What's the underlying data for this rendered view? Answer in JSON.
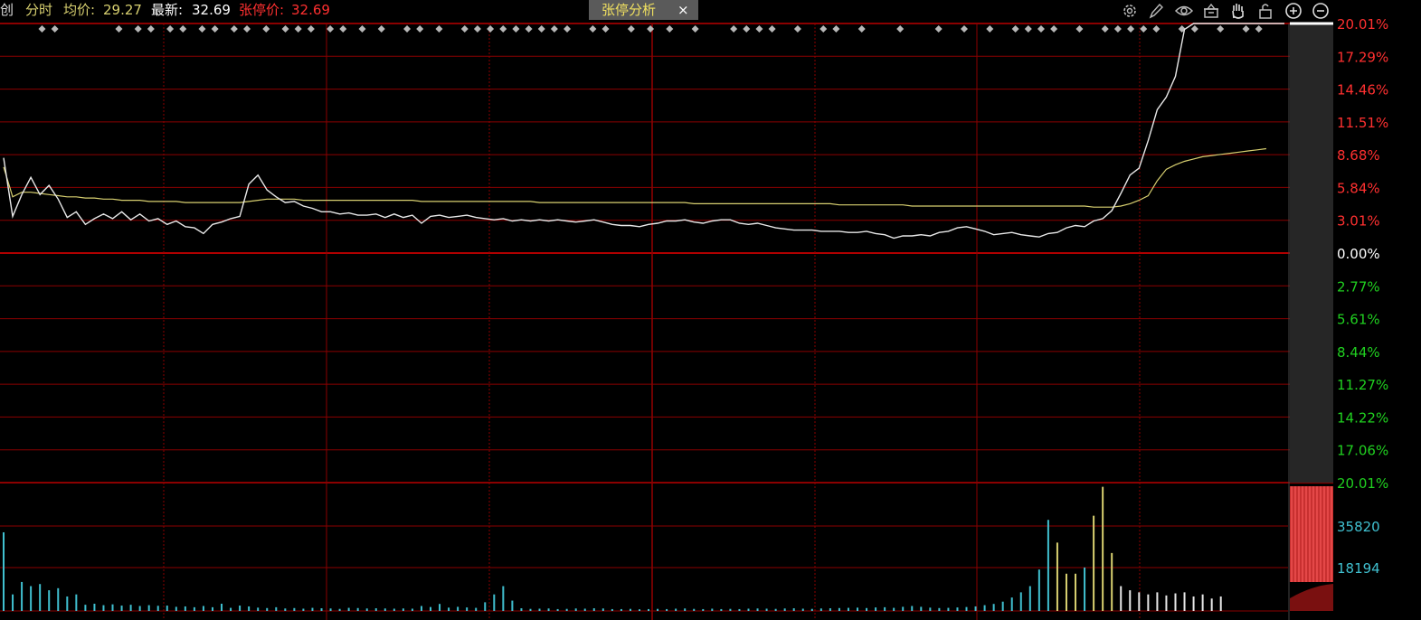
{
  "header": {
    "stock_name_fragment": "创",
    "mode_label": "分时",
    "avg_label": "均价:",
    "avg_value": "29.27",
    "latest_label": "最新:",
    "latest_value": "32.69",
    "limit_label": "张停价:",
    "limit_value": "32.69"
  },
  "tab": {
    "label": "张停分析",
    "close_glyph": "×"
  },
  "toolbar": {
    "icons": [
      "gear-icon",
      "pen-icon",
      "eye-icon",
      "basket-icon",
      "hand-icon",
      "lock-icon",
      "zoom-in-icon",
      "zoom-out-icon"
    ]
  },
  "colors": {
    "grid": "#8b0000",
    "price_line": "#e8e8e8",
    "avg_line": "#d8d070",
    "up_pct": "#ff3030",
    "down_pct": "#20d020",
    "volume_bar": "#40c0d0",
    "volume_bar_up": "#d8d070",
    "marker": "#b8b8b8",
    "tab_bg": "#5a5a5a",
    "tab_text": "#f0e060"
  },
  "chart_data": {
    "type": "line",
    "y_ticks_up": [
      "20.01%",
      "17.29%",
      "14.46%",
      "11.51%",
      "8.68%",
      "5.84%",
      "3.01%"
    ],
    "y_tick_zero": "0.00%",
    "y_ticks_down": [
      "2.77%",
      "5.61%",
      "8.44%",
      "11.27%",
      "14.22%",
      "17.06%",
      "20.01%"
    ],
    "ylim": [
      -20.01,
      20.01
    ],
    "volume_ticks": [
      "35820",
      "18194"
    ],
    "grid": true,
    "price_pct": [
      8.3,
      3.2,
      5.1,
      6.6,
      5.1,
      5.9,
      4.7,
      3.1,
      3.6,
      2.5,
      3.0,
      3.4,
      3.0,
      3.6,
      2.9,
      3.4,
      2.8,
      3.0,
      2.5,
      2.8,
      2.3,
      2.2,
      1.7,
      2.5,
      2.7,
      3.0,
      3.2,
      6.0,
      6.8,
      5.5,
      4.9,
      4.4,
      4.5,
      4.1,
      3.9,
      3.6,
      3.6,
      3.4,
      3.5,
      3.3,
      3.3,
      3.4,
      3.1,
      3.4,
      3.1,
      3.3,
      2.6,
      3.2,
      3.3,
      3.1,
      3.2,
      3.3,
      3.1,
      3.0,
      2.9,
      3.0,
      2.8,
      2.9,
      2.8,
      2.9,
      2.8,
      2.9,
      2.8,
      2.7,
      2.8,
      2.9,
      2.7,
      2.5,
      2.4,
      2.4,
      2.3,
      2.5,
      2.6,
      2.8,
      2.8,
      2.9,
      2.7,
      2.6,
      2.8,
      2.9,
      2.9,
      2.6,
      2.5,
      2.6,
      2.4,
      2.2,
      2.1,
      2.0,
      2.0,
      2.0,
      1.9,
      1.9,
      1.9,
      1.8,
      1.8,
      1.9,
      1.7,
      1.6,
      1.3,
      1.5,
      1.5,
      1.6,
      1.5,
      1.8,
      1.9,
      2.2,
      2.3,
      2.1,
      1.9,
      1.6,
      1.7,
      1.8,
      1.6,
      1.5,
      1.4,
      1.7,
      1.8,
      2.2,
      2.4,
      2.3,
      2.8,
      3.0,
      3.7,
      5.2,
      6.8,
      7.4,
      9.8,
      12.5,
      13.6,
      15.4,
      19.5,
      20.01,
      20.01,
      20.01,
      20.01,
      20.01,
      20.01,
      20.01,
      20.01,
      20.01,
      20.01,
      20.01
    ],
    "avg_pct": [
      7.5,
      4.9,
      5.3,
      5.3,
      5.2,
      5.1,
      5.0,
      4.9,
      4.9,
      4.8,
      4.8,
      4.7,
      4.7,
      4.6,
      4.6,
      4.6,
      4.5,
      4.5,
      4.5,
      4.5,
      4.4,
      4.4,
      4.4,
      4.4,
      4.4,
      4.4,
      4.4,
      4.5,
      4.6,
      4.7,
      4.7,
      4.7,
      4.7,
      4.6,
      4.6,
      4.6,
      4.6,
      4.6,
      4.6,
      4.6,
      4.6,
      4.6,
      4.6,
      4.6,
      4.6,
      4.6,
      4.5,
      4.5,
      4.5,
      4.5,
      4.5,
      4.5,
      4.5,
      4.5,
      4.5,
      4.5,
      4.5,
      4.5,
      4.5,
      4.4,
      4.4,
      4.4,
      4.4,
      4.4,
      4.4,
      4.4,
      4.4,
      4.4,
      4.4,
      4.4,
      4.4,
      4.4,
      4.4,
      4.4,
      4.4,
      4.4,
      4.3,
      4.3,
      4.3,
      4.3,
      4.3,
      4.3,
      4.3,
      4.3,
      4.3,
      4.3,
      4.3,
      4.3,
      4.3,
      4.3,
      4.3,
      4.3,
      4.2,
      4.2,
      4.2,
      4.2,
      4.2,
      4.2,
      4.2,
      4.2,
      4.1,
      4.1,
      4.1,
      4.1,
      4.1,
      4.1,
      4.1,
      4.1,
      4.1,
      4.1,
      4.1,
      4.1,
      4.1,
      4.1,
      4.1,
      4.1,
      4.1,
      4.1,
      4.1,
      4.1,
      4.0,
      4.0,
      4.0,
      4.1,
      4.3,
      4.6,
      5.0,
      6.3,
      7.3,
      7.7,
      8.0,
      8.2,
      8.4,
      8.5,
      8.6,
      8.7,
      8.8,
      8.9,
      9.0,
      9.1
    ],
    "volume": [
      38000,
      8000,
      14000,
      12000,
      13000,
      10000,
      11000,
      7000,
      8000,
      3000,
      3500,
      2800,
      3200,
      2600,
      3000,
      2400,
      2800,
      2500,
      2600,
      2000,
      2200,
      1800,
      2400,
      1800,
      3500,
      1500,
      2600,
      2200,
      1600,
      1400,
      1800,
      1200,
      1400,
      1100,
      1500,
      1300,
      1200,
      1000,
      1500,
      1400,
      1200,
      1300,
      1200,
      1100,
      1200,
      1100,
      2400,
      1900,
      3400,
      1600,
      2000,
      1700,
      1500,
      4200,
      8000,
      12000,
      5000,
      1300,
      1000,
      1100,
      1200,
      900,
      1000,
      1200,
      1100,
      1300,
      1200,
      900,
      900,
      1000,
      800,
      900,
      1000,
      900,
      1100,
      1200,
      1000,
      900,
      1100,
      900,
      1000,
      900,
      1100,
      1200,
      1100,
      1000,
      1200,
      1300,
      1100,
      1000,
      1200,
      1300,
      1400,
      1500,
      1600,
      1400,
      1700,
      1800,
      1500,
      2000,
      2400,
      2000,
      1600,
      1400,
      1500,
      1700,
      1900,
      2200,
      2800,
      3400,
      4500,
      6500,
      9000,
      12000,
      20000,
      44000,
      33000,
      18000,
      18000,
      21000,
      46000,
      60000,
      28000,
      12000,
      10000,
      9000,
      8000,
      9000,
      7500,
      8500,
      9000,
      7000,
      8000,
      6000,
      7000
    ],
    "vol_max": 62000,
    "tick_markers": [
      6,
      8,
      18,
      21,
      23,
      26,
      28,
      31,
      33,
      36,
      38,
      41,
      44,
      46,
      48,
      51,
      53,
      56,
      59,
      63,
      65,
      68,
      72,
      74,
      76,
      78,
      80,
      82,
      84,
      86,
      88,
      92,
      94,
      98,
      101,
      104,
      108,
      114,
      116,
      118,
      120,
      124,
      128,
      130,
      134,
      140,
      146,
      150,
      154,
      158,
      160,
      162,
      164,
      168,
      172,
      174,
      176,
      178,
      180,
      184,
      186,
      190,
      194,
      196
    ]
  }
}
